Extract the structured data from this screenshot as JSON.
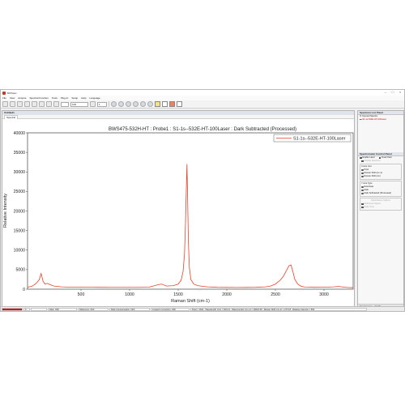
{
  "window": {
    "title": "BWSpec"
  },
  "menubar": [
    "File",
    "View",
    "Acquire",
    "Spectral Function",
    "Tools",
    "Plug-In",
    "Setup",
    "Help",
    "Language"
  ],
  "toolbar": {
    "integration_value": "100",
    "average_value": "1"
  },
  "document": {
    "name": "Untitled1",
    "tab": "Spectral"
  },
  "chart_title": "BWS475-532H-HT : Probe1 : S1-1s--532E-HT-100Laser : Dark Subtracted (Processed)",
  "chart_data": {
    "type": "line",
    "title": "BWS475-532H-HT : Probe1 : S1-1s--532E-HT-100Laser : Dark Subtracted (Processed)",
    "xlabel": "Raman Shift (cm-1)",
    "ylabel": "Relative Intensity",
    "xlim": [
      -50,
      3300
    ],
    "ylim": [
      0,
      40000
    ],
    "xticks": [
      500,
      1000,
      1500,
      2000,
      2500,
      3000
    ],
    "yticks": [
      0,
      5000,
      10000,
      15000,
      20000,
      25000,
      30000,
      35000,
      40000
    ],
    "grid": false,
    "legend_position": "top-right",
    "series": [
      {
        "name": "S1-1s--532E-HT-100Laser",
        "color": "#e8402a",
        "x": [
          -50,
          0,
          40,
          70,
          90,
          110,
          130,
          150,
          180,
          220,
          300,
          400,
          500,
          600,
          700,
          800,
          900,
          1000,
          1100,
          1200,
          1300,
          1330,
          1350,
          1380,
          1450,
          1500,
          1530,
          1550,
          1565,
          1575,
          1585,
          1590,
          1595,
          1605,
          1615,
          1630,
          1660,
          1700,
          1800,
          1900,
          2000,
          2100,
          2200,
          2300,
          2400,
          2450,
          2500,
          2550,
          2580,
          2610,
          2640,
          2660,
          2680,
          2700,
          2730,
          2760,
          2800,
          2900,
          3000,
          3100,
          3150,
          3200,
          3250,
          3300
        ],
        "y": [
          500,
          800,
          1500,
          2400,
          4000,
          2000,
          1300,
          1500,
          1200,
          800,
          600,
          500,
          500,
          500,
          480,
          460,
          460,
          460,
          470,
          520,
          1200,
          1300,
          1100,
          800,
          900,
          1300,
          2300,
          4500,
          9000,
          17000,
          27000,
          32000,
          26000,
          12000,
          5500,
          2500,
          1300,
          900,
          600,
          480,
          450,
          440,
          450,
          480,
          600,
          800,
          1300,
          2300,
          3200,
          4600,
          6000,
          6200,
          4500,
          2500,
          1300,
          800,
          550,
          480,
          500,
          600,
          700,
          550,
          420,
          400
        ]
      }
    ]
  },
  "right_panel": {
    "spectrum_list_title": "Spectrum List Panel",
    "opened_spectra_label": "Opened Spectra",
    "spectrum_item": "S1-1s-532E-HT-100Laser",
    "control_title": "Spectrometer Control Panel",
    "enable_laser": "Enable Laser",
    "dual_chart": "Dual Chart",
    "grayed_option": "Display Spectrum",
    "x_axis_unit_label": "X Axis Unit",
    "x_units": [
      "Pixel",
      "Raman Shift (cm-1)",
      "Raman Shift (nm)"
    ],
    "y_axis_type_label": "Y Axis Type",
    "y_types": [
      "Raw Data",
      "Dark",
      "Dark Subtracted (Processed)"
    ],
    "disabled_group": "Absorbance Options",
    "disabled_items": [
      "Reference Signal",
      "Ratio Time"
    ],
    "bottom_tabs": [
      "Spectrometer",
      "Details"
    ]
  },
  "statusbar": {
    "cells": [
      "",
      "0",
      "",
      "Dark: OFF",
      "Reference: OFF",
      "Dark Compensation: OFF",
      "Linearity Correction: OFF",
      "Pixel = 1621 ; Wavelength (nm) = 624.12 ; Wavenumber (cm-1) = 16022.35 ; Raman Shift (cm-1) = 2774.8 ; Relative intensity = 563"
    ]
  }
}
